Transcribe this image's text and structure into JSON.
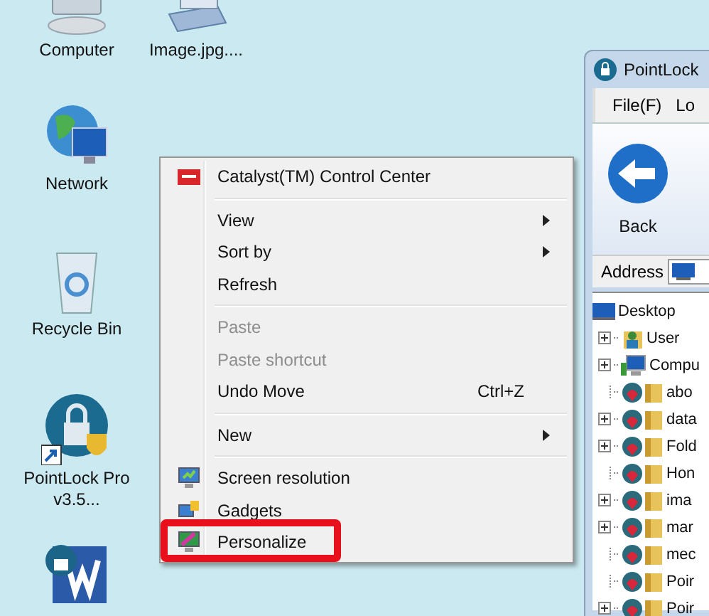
{
  "desktop_icons": [
    {
      "kind": "computer",
      "label": "Computer"
    },
    {
      "kind": "image",
      "label": "Image.jpg...."
    },
    {
      "kind": "network",
      "label": "Network"
    },
    {
      "kind": "recycle",
      "label": "Recycle Bin"
    },
    {
      "kind": "lock",
      "label": "PointLock Pro v3.5..."
    },
    {
      "kind": "doc"
    }
  ],
  "context_menu": {
    "groups": [
      [
        {
          "label": "Catalyst(TM) Control Center",
          "disabled": false,
          "submenu": false
        }
      ],
      [
        {
          "label": "View",
          "disabled": false,
          "submenu": true
        },
        {
          "label": "Sort by",
          "disabled": false,
          "submenu": true
        },
        {
          "label": "Refresh",
          "disabled": false,
          "submenu": false
        }
      ],
      [
        {
          "label": "Paste",
          "disabled": true,
          "submenu": false
        },
        {
          "label": "Paste shortcut",
          "disabled": true,
          "submenu": false
        },
        {
          "label": "Undo Move",
          "shortcut": "Ctrl+Z",
          "disabled": false,
          "submenu": false
        }
      ],
      [
        {
          "label": "New",
          "disabled": false,
          "submenu": true
        }
      ],
      [
        {
          "label": "Screen resolution",
          "disabled": false,
          "submenu": false
        },
        {
          "label": "Gadgets",
          "disabled": false,
          "submenu": false
        },
        {
          "label": "Personalize",
          "disabled": false,
          "submenu": false
        }
      ]
    ]
  },
  "window": {
    "title": "PointLock",
    "menu": [
      "File(F)",
      "Lo"
    ],
    "toolbar": [
      {
        "label": "Back"
      }
    ],
    "address_label": "Address",
    "tree": {
      "label": "Desktop",
      "children": [
        {
          "kind": "user",
          "label": "User",
          "expandable": true
        },
        {
          "kind": "computer",
          "label": "Compu",
          "expandable": true
        },
        {
          "kind": "locked",
          "label": "abo",
          "expandable": false
        },
        {
          "kind": "locked",
          "label": "data",
          "expandable": true
        },
        {
          "kind": "locked",
          "label": "Fold",
          "expandable": true
        },
        {
          "kind": "locked",
          "label": "Hon",
          "expandable": false
        },
        {
          "kind": "locked",
          "label": "ima",
          "expandable": true
        },
        {
          "kind": "locked",
          "label": "mar",
          "expandable": true
        },
        {
          "kind": "locked",
          "label": "mec",
          "expandable": false
        },
        {
          "kind": "locked",
          "label": "Poir",
          "expandable": false
        },
        {
          "kind": "locked",
          "label": "Poir",
          "expandable": true
        }
      ]
    }
  }
}
